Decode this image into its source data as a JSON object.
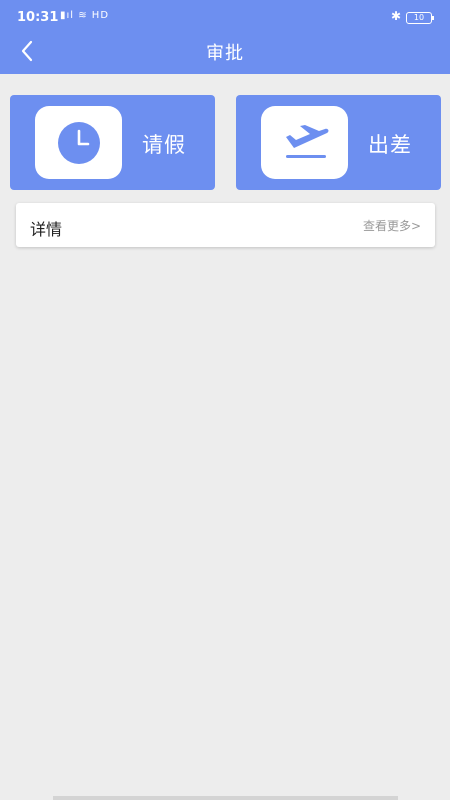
{
  "status_bar": {
    "time": "10:31",
    "signal_text": "▮ıl ≋ HD",
    "bluetooth": "✱",
    "battery": "10"
  },
  "header": {
    "title": "审批",
    "back_icon": "chevron-left-icon"
  },
  "actions": [
    {
      "label": "请假",
      "icon": "clock-icon"
    },
    {
      "label": "出差",
      "icon": "plane-departure-icon"
    }
  ],
  "detail": {
    "title": "详情",
    "more_label": "查看更多>"
  },
  "colors": {
    "accent": "#6d8ff0",
    "background": "#ededed"
  }
}
